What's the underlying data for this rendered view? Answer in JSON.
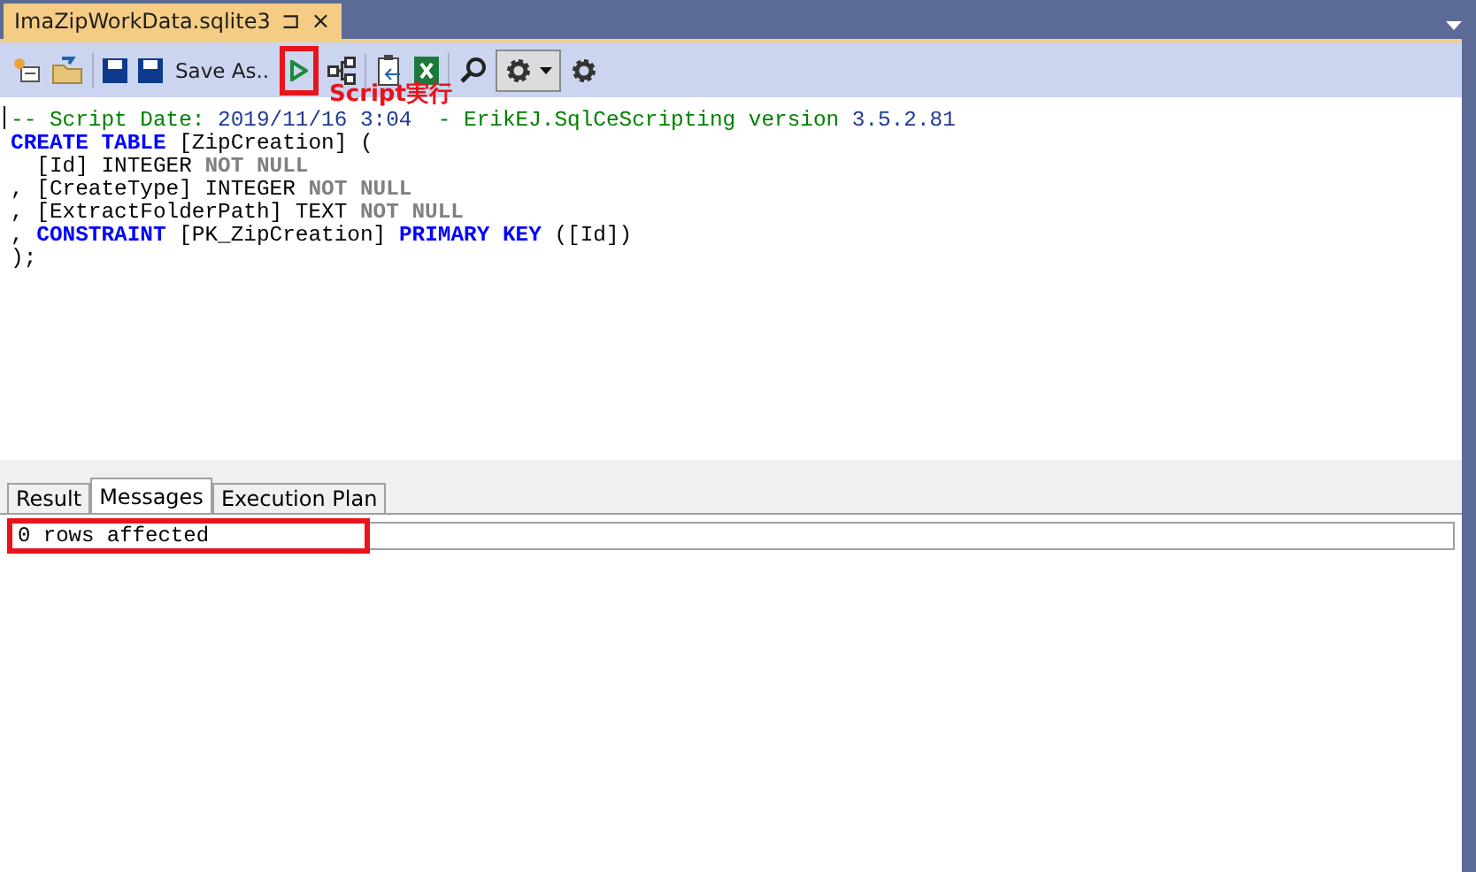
{
  "document_tab": {
    "title": "ImaZipWorkData.sqlite3",
    "pin": "⊐",
    "close": "×"
  },
  "toolbar": {
    "items": [
      {
        "kind": "icon"
      },
      {
        "kind": "icon"
      },
      {
        "kind": "sep"
      },
      {
        "kind": "icon"
      },
      {
        "kind": "icon"
      },
      {
        "kind": "text",
        "label": "Save As.."
      },
      {
        "kind": "icon",
        "highlighted": true
      },
      {
        "kind": "icon"
      },
      {
        "kind": "sep"
      },
      {
        "kind": "icon"
      },
      {
        "kind": "icon"
      },
      {
        "kind": "sep"
      },
      {
        "kind": "icon"
      },
      {
        "kind": "dropdown"
      },
      {
        "kind": "icon"
      }
    ]
  },
  "annotation": {
    "label": "Script実行"
  },
  "script": {
    "lines": [
      [
        {
          "kind": "comment",
          "text": "-- Script Date: "
        },
        {
          "kind": "number",
          "text": "2019/11/16 3:04"
        },
        {
          "kind": "comment",
          "text": "  - ErikEJ.SqlCeScripting version "
        },
        {
          "kind": "number",
          "text": "3.5.2.81"
        }
      ],
      [
        {
          "kind": "keyword",
          "text": "CREATE TABLE"
        },
        {
          "kind": "plain",
          "text": " [ZipCreation] ("
        }
      ],
      [
        {
          "kind": "plain",
          "text": "  [Id] INTEGER "
        },
        {
          "kind": "muted",
          "text": "NOT NULL"
        }
      ],
      [
        {
          "kind": "plain",
          "text": ", [CreateType] INTEGER "
        },
        {
          "kind": "muted",
          "text": "NOT NULL"
        }
      ],
      [
        {
          "kind": "plain",
          "text": ", [ExtractFolderPath] TEXT "
        },
        {
          "kind": "muted",
          "text": "NOT NULL"
        }
      ],
      [
        {
          "kind": "plain",
          "text": ", "
        },
        {
          "kind": "keyword",
          "text": "CONSTRAINT"
        },
        {
          "kind": "plain",
          "text": " [PK_ZipCreation] "
        },
        {
          "kind": "keyword",
          "text": "PRIMARY KEY"
        },
        {
          "kind": "plain",
          "text": " ([Id])"
        }
      ],
      [
        {
          "kind": "plain",
          "text": ");"
        }
      ]
    ]
  },
  "result_tabs": [
    {
      "label": "Result",
      "selected": false
    },
    {
      "label": "Messages",
      "selected": true
    },
    {
      "label": "Execution Plan",
      "selected": false
    }
  ],
  "messages": {
    "value": "0 rows affected",
    "highlighted": true
  }
}
